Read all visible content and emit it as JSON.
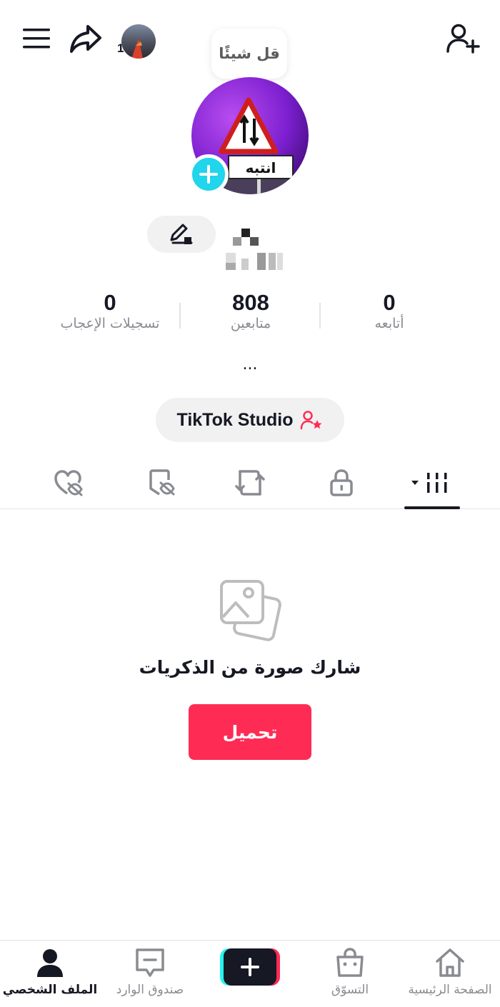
{
  "header": {
    "menu_icon": "hamburger-menu-icon",
    "share_icon": "share-arrow-icon",
    "mini_avatar_count": "1",
    "add_friend_icon": "person-plus-icon"
  },
  "note": {
    "text": "قل شيئًا"
  },
  "profile": {
    "avatar_sign_text": "انتبه",
    "add_icon": "plus-icon",
    "edit_icon": "pencil-icon"
  },
  "stats": {
    "following": {
      "value": "0",
      "label": "أتابعه"
    },
    "followers": {
      "value": "808",
      "label": "متابعين"
    },
    "likes": {
      "value": "0",
      "label": "تسجيلات الإعجاب"
    }
  },
  "bio": {
    "text": "..."
  },
  "studio": {
    "label": "TikTok Studio",
    "icon": "person-star-icon"
  },
  "tabs": [
    {
      "name": "videos-grid",
      "icon": "grid-bars-icon",
      "active": true
    },
    {
      "name": "private",
      "icon": "lock-icon"
    },
    {
      "name": "reposts",
      "icon": "repost-icon"
    },
    {
      "name": "favorites",
      "icon": "bookmark-hidden-icon"
    },
    {
      "name": "liked",
      "icon": "heart-hidden-icon"
    }
  ],
  "empty_state": {
    "icon": "photos-icon",
    "title": "شارك صورة من الذكريات",
    "button_label": "تحميل"
  },
  "bottom_nav": {
    "home": "الصفحة الرئيسية",
    "shop": "التسوّق",
    "create_icon": "plus-icon",
    "inbox": "صندوق الوارد",
    "profile": "الملف الشخصي"
  },
  "colors": {
    "accent": "#fe2c55",
    "cyan": "#20d5ec",
    "text": "#161823",
    "muted": "#8a8b91"
  }
}
